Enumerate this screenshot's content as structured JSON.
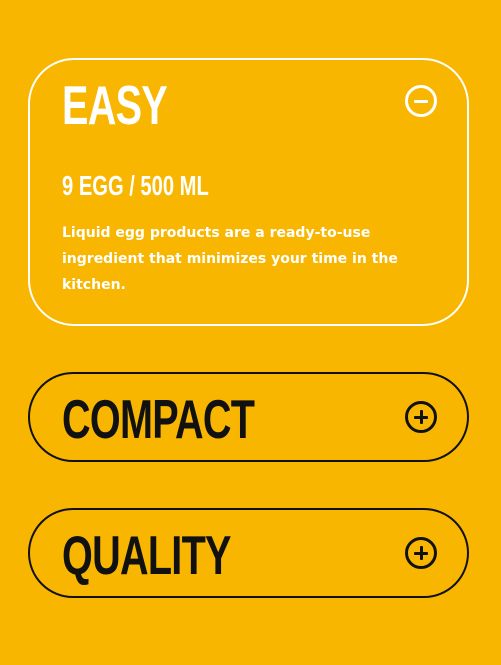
{
  "colors": {
    "background": "#F8B600",
    "open_border": "#ffffff",
    "closed_border": "#111111"
  },
  "accordion": [
    {
      "title": "EASY",
      "expanded": true,
      "toggle_icon": "minus-circle-icon",
      "subtitle": "9 EGG / 500 ML",
      "description": "Liquid egg products are a ready-to-use ingredient that minimizes your time in the kitchen."
    },
    {
      "title": "COMPACT",
      "expanded": false,
      "toggle_icon": "plus-circle-icon"
    },
    {
      "title": "QUALITY",
      "expanded": false,
      "toggle_icon": "plus-circle-icon"
    }
  ]
}
